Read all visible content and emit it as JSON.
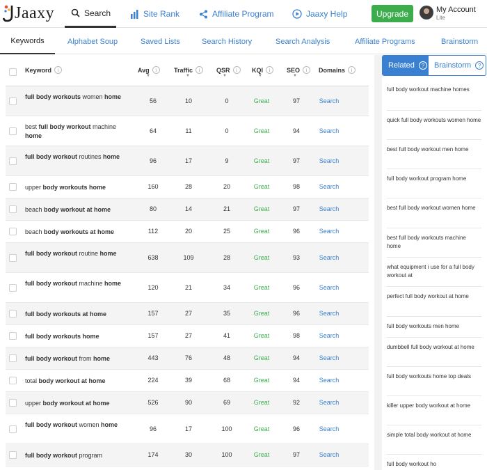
{
  "brand": {
    "logo_text": "Jaaxy"
  },
  "nav": {
    "search": "Search",
    "site_rank": "Site Rank",
    "affiliate_program": "Affiliate Program",
    "jaaxy_help": "Jaaxy Help",
    "upgrade": "Upgrade",
    "account_name": "My Account",
    "account_plan": "Lite"
  },
  "tabs": [
    "Keywords",
    "Alphabet Soup",
    "Saved Lists",
    "Search History",
    "Search Analysis",
    "Affiliate Programs",
    "Brainstorm"
  ],
  "table": {
    "headers": {
      "keyword": "Keyword",
      "avg": "Avg",
      "traffic": "Traffic",
      "qsr": "QSR",
      "kqi": "KQI",
      "seo": "SEO",
      "domains": "Domains"
    },
    "rows": [
      {
        "pre": "",
        "b1": "full body workouts",
        "mid": " women ",
        "b2": "home",
        "post": "",
        "avg": "56",
        "traffic": "10",
        "qsr": "0",
        "kqi": "Great",
        "seo": "97",
        "domains": "Search"
      },
      {
        "pre": "best ",
        "b1": "full body workout",
        "mid": " machine ",
        "b2": "home",
        "post": "",
        "avg": "64",
        "traffic": "11",
        "qsr": "0",
        "kqi": "Great",
        "seo": "94",
        "domains": "Search"
      },
      {
        "pre": "",
        "b1": "full body workout",
        "mid": " routines ",
        "b2": "home",
        "post": "",
        "avg": "96",
        "traffic": "17",
        "qsr": "9",
        "kqi": "Great",
        "seo": "97",
        "domains": "Search"
      },
      {
        "pre": "upper ",
        "b1": "body workouts home",
        "mid": "",
        "b2": "",
        "post": "",
        "avg": "160",
        "traffic": "28",
        "qsr": "20",
        "kqi": "Great",
        "seo": "98",
        "domains": "Search"
      },
      {
        "pre": "beach ",
        "b1": "body workout at home",
        "mid": "",
        "b2": "",
        "post": "",
        "avg": "80",
        "traffic": "14",
        "qsr": "21",
        "kqi": "Great",
        "seo": "97",
        "domains": "Search"
      },
      {
        "pre": "beach ",
        "b1": "body workouts at home",
        "mid": "",
        "b2": "",
        "post": "",
        "avg": "112",
        "traffic": "20",
        "qsr": "25",
        "kqi": "Great",
        "seo": "96",
        "domains": "Search"
      },
      {
        "pre": "",
        "b1": "full body workout",
        "mid": " routine ",
        "b2": "home",
        "post": "",
        "avg": "638",
        "traffic": "109",
        "qsr": "28",
        "kqi": "Great",
        "seo": "93",
        "domains": "Search"
      },
      {
        "pre": "",
        "b1": "full body workout",
        "mid": " machine ",
        "b2": "home",
        "post": "",
        "avg": "120",
        "traffic": "21",
        "qsr": "34",
        "kqi": "Great",
        "seo": "96",
        "domains": "Search"
      },
      {
        "pre": "",
        "b1": "full body workouts at home",
        "mid": "",
        "b2": "",
        "post": "",
        "avg": "157",
        "traffic": "27",
        "qsr": "35",
        "kqi": "Great",
        "seo": "96",
        "domains": "Search"
      },
      {
        "pre": "",
        "b1": "full body workouts home",
        "mid": "",
        "b2": "",
        "post": "",
        "avg": "157",
        "traffic": "27",
        "qsr": "41",
        "kqi": "Great",
        "seo": "98",
        "domains": "Search"
      },
      {
        "pre": "",
        "b1": "full body workout",
        "mid": " from ",
        "b2": "home",
        "post": "",
        "avg": "443",
        "traffic": "76",
        "qsr": "48",
        "kqi": "Great",
        "seo": "94",
        "domains": "Search"
      },
      {
        "pre": "total ",
        "b1": "body workout at home",
        "mid": "",
        "b2": "",
        "post": "",
        "avg": "224",
        "traffic": "39",
        "qsr": "68",
        "kqi": "Great",
        "seo": "94",
        "domains": "Search"
      },
      {
        "pre": "upper ",
        "b1": "body workout at home",
        "mid": "",
        "b2": "",
        "post": "",
        "avg": "526",
        "traffic": "90",
        "qsr": "69",
        "kqi": "Great",
        "seo": "92",
        "domains": "Search"
      },
      {
        "pre": "",
        "b1": "full body workout",
        "mid": " women ",
        "b2": "home",
        "post": "",
        "avg": "96",
        "traffic": "17",
        "qsr": "100",
        "kqi": "Great",
        "seo": "96",
        "domains": "Search"
      },
      {
        "pre": "",
        "b1": "full body workout",
        "mid": " program",
        "b2": "",
        "post": "",
        "avg": "174",
        "traffic": "30",
        "qsr": "100",
        "kqi": "Great",
        "seo": "97",
        "domains": "Search"
      }
    ]
  },
  "side_panel": {
    "tab_related": "Related",
    "tab_brainstorm": "Brainstorm",
    "items": [
      "full body workout machine homes",
      "quick full body workouts women home",
      "best full body workout men home",
      "full body workout program home",
      "best full body workout women home",
      "best full body workouts machine home",
      "what equipment i use for a full body workout at",
      "perfect full body workout at home",
      "full body workouts men home",
      "dumbbell full body workout at home",
      "full body workouts home top deals",
      "killer upper body workout at home",
      "simple total body workout at home",
      "full body workout ho"
    ]
  },
  "colors": {
    "accent": "#3a80d2",
    "upgrade": "#3cac4d",
    "great": "#3cac4d"
  },
  "icons": {
    "search": "search-icon",
    "site_rank": "bar-chart-icon",
    "affiliate": "share-icon",
    "help": "play-circle-icon",
    "info": "info-icon"
  }
}
